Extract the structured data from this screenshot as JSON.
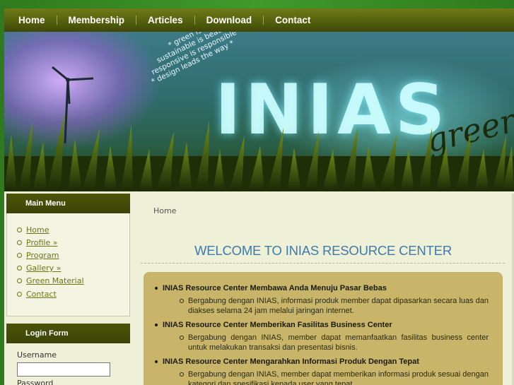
{
  "nav": {
    "items": [
      "Home",
      "Membership",
      "Articles",
      "Download",
      "Contact"
    ]
  },
  "banner": {
    "brand": "INIAS",
    "brand_sub": "green",
    "slogan_lines": [
      "* green is clean *",
      "sustainable is beautiful",
      "responsive is responsible",
      "* design leads the way *"
    ]
  },
  "main_menu": {
    "title": "Main Menu",
    "items": [
      "Home",
      "Profile »",
      "Program",
      "Gallery »",
      "Green Material",
      "Contact"
    ]
  },
  "login": {
    "title": "Login Form",
    "username_label": "Username",
    "password_label": "Password"
  },
  "content": {
    "breadcrumb": "Home",
    "welcome": "WELCOME TO INIAS RESOURCE CENTER",
    "features": [
      {
        "title": "INIAS Resource Center Membawa Anda Menuju Pasar Bebas",
        "desc": "Bergabung dengan INIAS, informasi produk member dapat dipasarkan secara luas dan diakses selama 24 jam melalui jaringan internet."
      },
      {
        "title": "INIAS Resource Center Memberikan Fasilitas Business Center",
        "desc": "Bergabung dengan INIAS, member dapat memanfaatkan fasilitas business center untuk melakukan transaksi dan presentasi bisnis."
      },
      {
        "title": "INIAS Resource Center Mengarahkan Informasi Produk Dengan Tepat",
        "desc": "Bergabung dengan INIAS, member dapat memberikan informasi produk sesuai dengan kategori dan spesifikasi kepada user yang tepat."
      }
    ]
  },
  "colors": {
    "nav_bg": "#55600e",
    "box_head": "#4a5508",
    "link": "#6a7614",
    "welcome": "#3f7aa8",
    "panel": "#c9b56a",
    "page_bg": "#eef0d8",
    "body_bg": "#3f9a2a"
  }
}
